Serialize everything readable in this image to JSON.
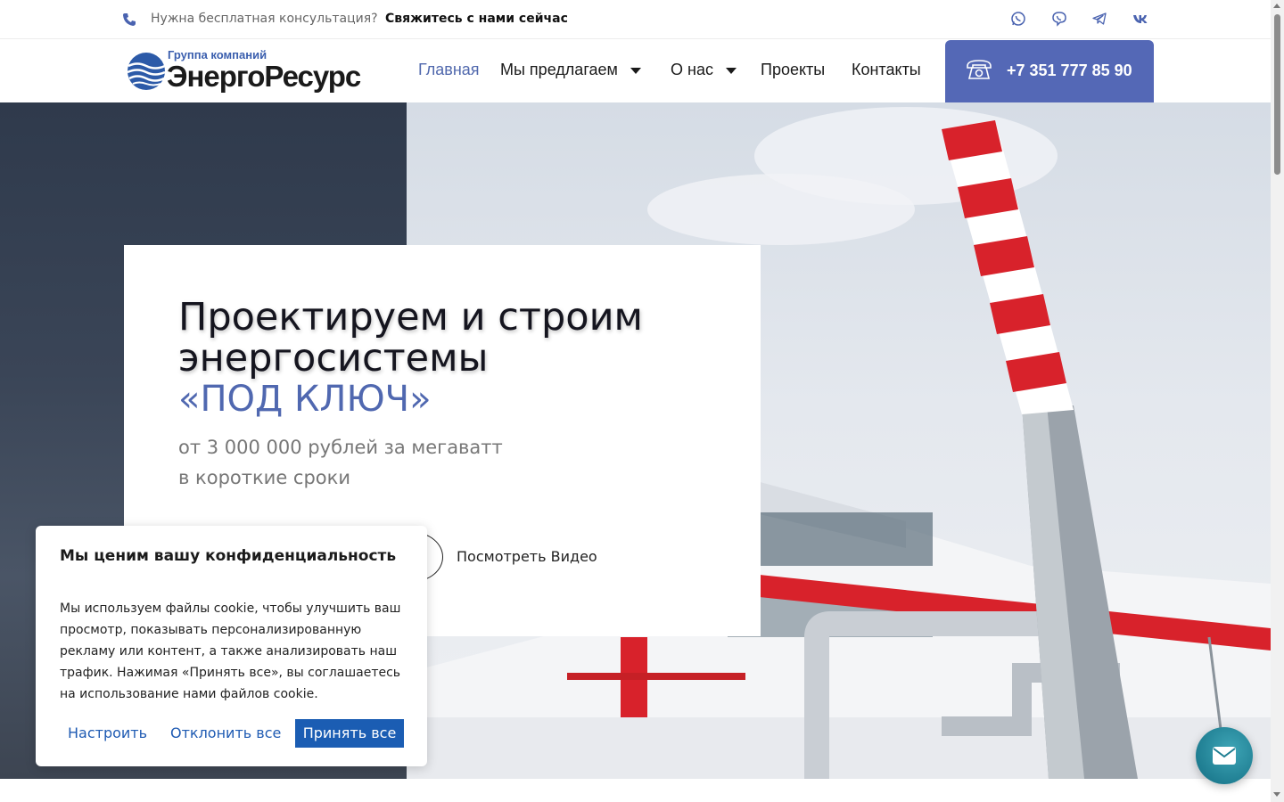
{
  "topbar": {
    "consult_text": "Нужна бесплатная консультация?",
    "contact_link": "Свяжитесь с нами сейчас",
    "social_icons": [
      "whatsapp-icon",
      "viber-icon",
      "telegram-icon",
      "vk-icon"
    ]
  },
  "header": {
    "logo_small": "Группа компаний",
    "logo_big": "ЭнергоРесурс",
    "nav": {
      "home": "Главная",
      "offer": "Мы предлагаем",
      "about": "О нас",
      "projects": "Проекты",
      "contacts": "Контакты"
    },
    "phone": "+7 351 777 85 90"
  },
  "hero": {
    "title": "Проектируем и строим энергосистемы",
    "accent": "«ПОД КЛЮЧ»",
    "subtitle_line1": "от 3 000 000 рублей за мегаватт",
    "subtitle_line2": "в короткие сроки",
    "video_label": "Посмотреть Видео"
  },
  "cookie": {
    "title": "Мы ценим вашу конфиденциальность",
    "text": "Мы используем файлы cookie, чтобы улучшить ваш просмотр, показывать персонализированную рекламу или контент, а также анализировать наш трафик. Нажимая «Принять все», вы соглашаетесь на использование нами файлов cookie.",
    "customize": "Настроить",
    "reject": "Отклонить все",
    "accept": "Принять все"
  },
  "colors": {
    "brand_blue": "#5468b6",
    "accent_text": "#5068b0",
    "cookie_blue": "#1b5db3",
    "fab_teal": "#1f7e92"
  }
}
